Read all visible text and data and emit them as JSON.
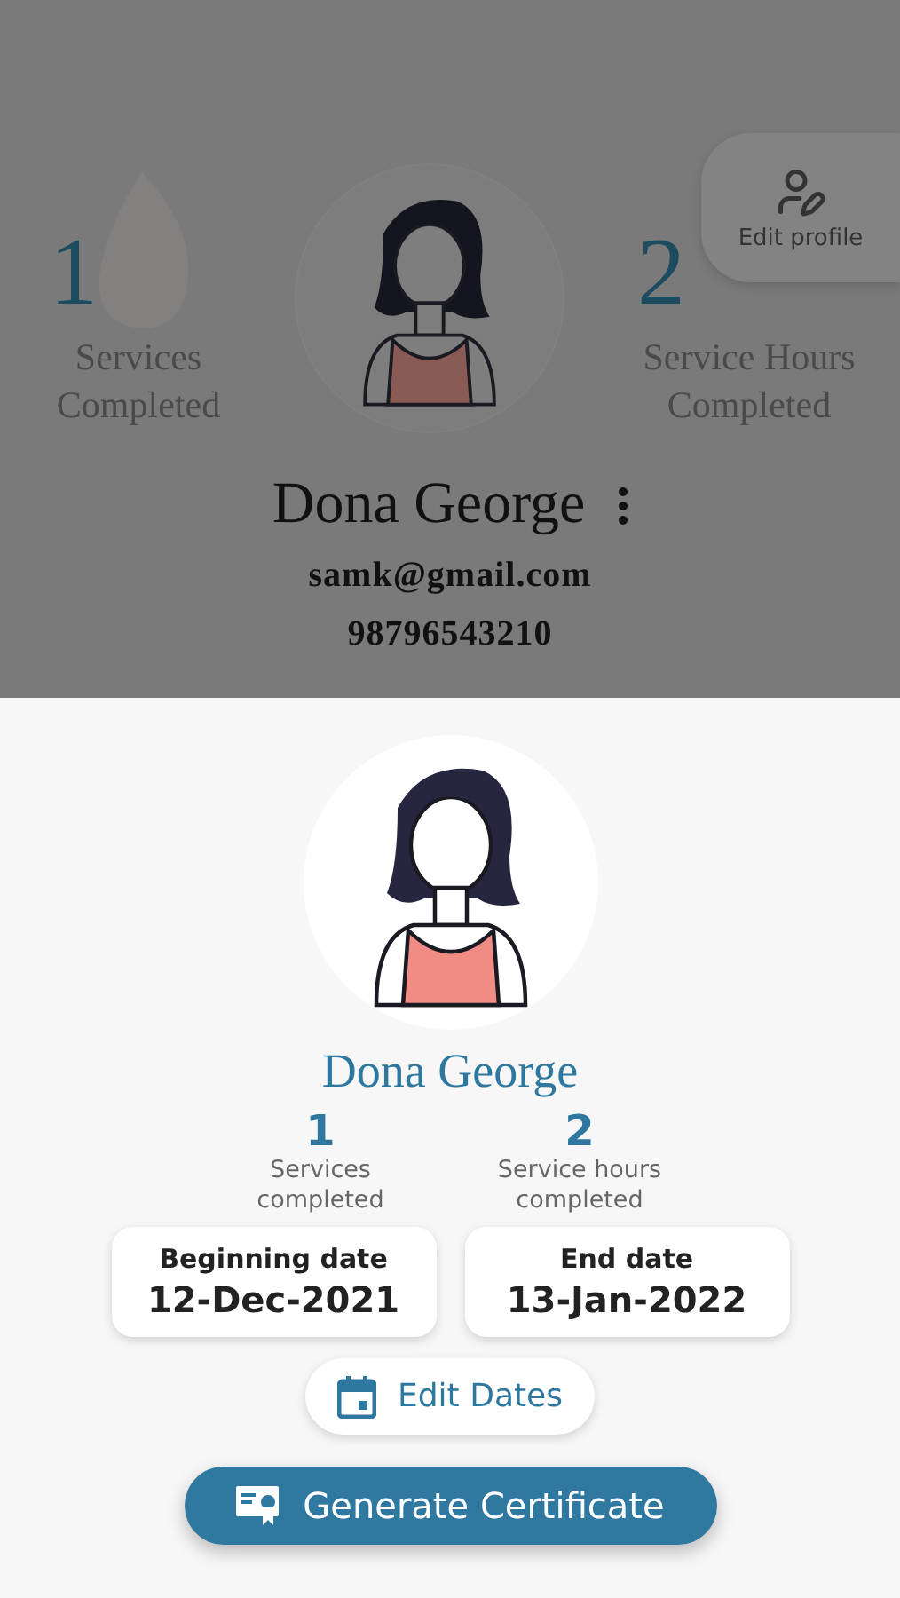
{
  "background_profile": {
    "stats": [
      {
        "value": "1",
        "label": "Services Completed"
      },
      {
        "value": "2",
        "label": "Service Hours Completed"
      }
    ],
    "name": "Dona George",
    "email": "samk@gmail.com",
    "phone": "98796543210",
    "edit_profile_button": "Edit profile"
  },
  "sheet": {
    "name": "Dona George",
    "stats": [
      {
        "value": "1",
        "label": "Services completed"
      },
      {
        "value": "2",
        "label": "Service hours completed"
      }
    ],
    "dates": [
      {
        "label": "Beginning date",
        "value": "12-Dec-2021"
      },
      {
        "label": "End date",
        "value": "13-Jan-2022"
      }
    ],
    "edit_dates_button": "Edit Dates",
    "generate_button": "Generate Certificate"
  }
}
